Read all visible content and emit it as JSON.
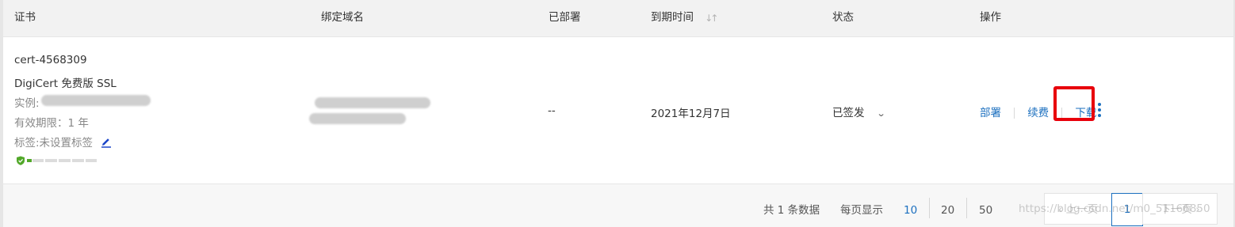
{
  "header": {
    "col_certificate": "证书",
    "col_domain": "绑定域名",
    "col_deployed": "已部署",
    "col_expiry": "到期时间",
    "col_status": "状态",
    "col_actions": "操作"
  },
  "row": {
    "cert_id": "cert-4568309",
    "cert_type": "DigiCert 免费版 SSL",
    "instance_label": "实例:",
    "validity": "有效期限：1 年",
    "tags": "标签:未设置标签",
    "deployed": "--",
    "expiry_date": "2021年12月7日",
    "status": "已签发",
    "actions": {
      "deploy": "部署",
      "renew": "续费",
      "download": "下载"
    }
  },
  "footer": {
    "total": "共 1 条数据",
    "per_page_label": "每页显示",
    "page_sizes": [
      "10",
      "20",
      "50"
    ],
    "selected_page_size": "10",
    "prev_label": "上一页",
    "current_page": "1",
    "next_label": "下一页"
  },
  "watermark": "https://blog.csdn.net/m0_51166850",
  "colors": {
    "link": "#1b6fbf",
    "highlight": "#e8000b",
    "secure": "#52a82a"
  },
  "icons": {
    "sort": "sort-arrows-icon",
    "edit": "pencil-icon",
    "status_dropdown": "chevron-down-icon",
    "more": "more-vertical-icon",
    "secure": "shield-check-icon"
  }
}
